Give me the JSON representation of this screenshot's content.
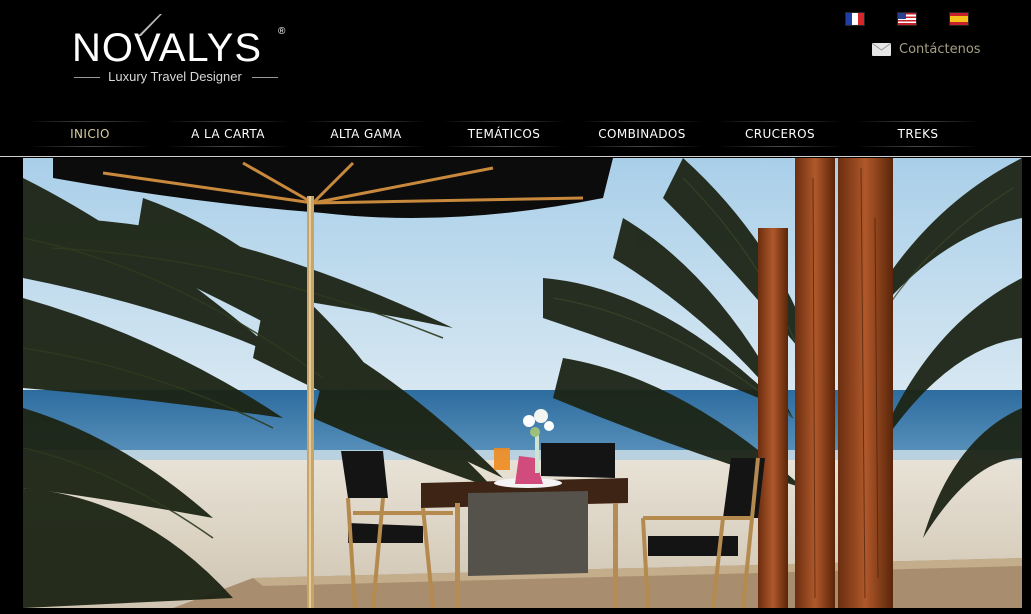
{
  "brand": {
    "name": "NOVALYS",
    "registered": "®",
    "tagline": "Luxury Travel Designer"
  },
  "languages": [
    {
      "code": "fr",
      "icon": "france-flag-icon"
    },
    {
      "code": "en",
      "icon": "usa-flag-icon"
    },
    {
      "code": "es",
      "icon": "spain-flag-icon"
    }
  ],
  "contact": {
    "label": "Contáctenos",
    "icon": "envelope-icon"
  },
  "nav": {
    "items": [
      {
        "label": "INICIO",
        "active": true
      },
      {
        "label": "A LA CARTA",
        "active": false
      },
      {
        "label": "ALTA GAMA",
        "active": false
      },
      {
        "label": "TEMÁTICOS",
        "active": false
      },
      {
        "label": "COMBINADOS",
        "active": false
      },
      {
        "label": "CRUCEROS",
        "active": false
      },
      {
        "label": "TREKS",
        "active": false
      }
    ]
  },
  "hero": {
    "description": "beach dining scene"
  },
  "colors": {
    "background": "#000000",
    "nav_active": "#d8cfa2",
    "contact_text": "#a59f86"
  }
}
